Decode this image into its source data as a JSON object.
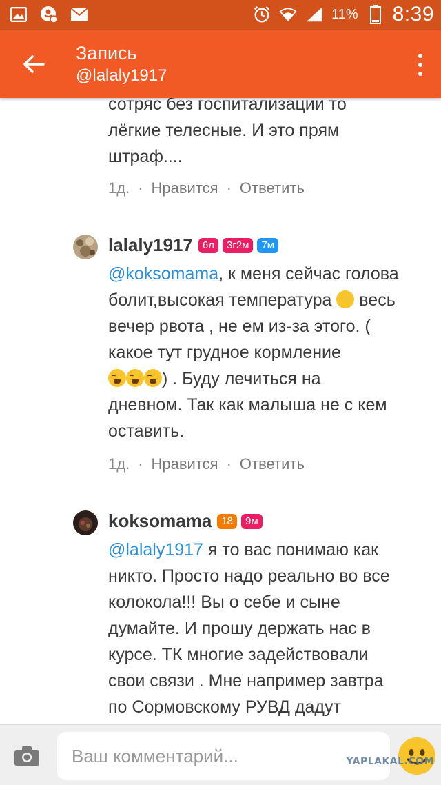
{
  "status_bar": {
    "battery_percent": "11%",
    "time": "8:39"
  },
  "app_bar": {
    "title": "Запись",
    "subtitle": "@lalaly1917"
  },
  "comments": [
    {
      "lines": [
        "сотряс без госпитализации то",
        "лёгкие телесные. И это прям",
        "штраф...."
      ],
      "meta": {
        "time": "1д.",
        "like": "Нравится",
        "reply": "Ответить"
      }
    },
    {
      "author": "lalaly1917",
      "badges": [
        {
          "text": "6л",
          "color": "#e91e63"
        },
        {
          "text": "3г2м",
          "color": "#e91e63"
        },
        {
          "text": "7м",
          "color": "#2196f3"
        }
      ],
      "mention": "@koksomama",
      "text_1": ", к меня сейчас голова",
      "text_2": "болит,высокая температура",
      "text_3": " весь",
      "text_4": "вечер рвота , не ем из-за этого. (",
      "text_5": "какое тут грудное кормление",
      "text_6": ") . Буду лечиться на",
      "text_7": "дневном. Так как малыша не с кем",
      "text_8": "оставить.",
      "meta": {
        "time": "1д.",
        "like": "Нравится",
        "reply": "Ответить"
      }
    },
    {
      "author": "koksomama",
      "badges": [
        {
          "text": "18",
          "color": "#f57c00"
        },
        {
          "text": "9м",
          "color": "#e91e63"
        }
      ],
      "mention": "@lalaly1917",
      "text_1": " я то вас понимаю как",
      "lines": [
        "никто. Просто надо реально во все",
        "колокола!!! Вы о себе и сыне",
        "думайте. И прошу держать нас в",
        "курсе.  ТК многие задействовали",
        "свои связи . Мне например завтра",
        "по Сормовскому РУВД дадут"
      ]
    }
  ],
  "composer": {
    "placeholder": "Ваш комментарий..."
  },
  "watermark": "YAPLAKAL.COM",
  "colors": {
    "app_bar": "#f15a24",
    "status_bar": "#d3521c",
    "mention": "#2c8fd6"
  }
}
